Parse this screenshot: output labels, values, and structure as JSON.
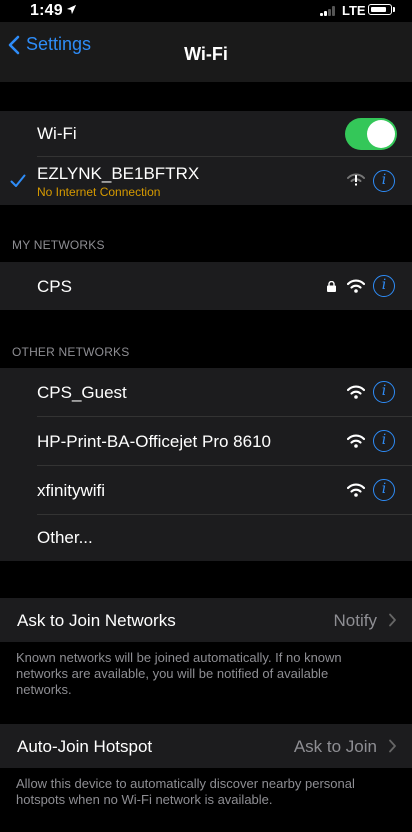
{
  "status_bar": {
    "time": "1:49",
    "network": "LTE"
  },
  "nav": {
    "back_label": "Settings",
    "title": "Wi-Fi"
  },
  "wifi_toggle": {
    "label": "Wi-Fi",
    "on": true
  },
  "connected_network": {
    "name": "EZLYNK_BE1BFTRX",
    "status": "No Internet Connection"
  },
  "my_networks": {
    "header": "MY NETWORKS",
    "items": [
      {
        "name": "CPS",
        "secured": true
      }
    ]
  },
  "other_networks": {
    "header": "OTHER NETWORKS",
    "items": [
      {
        "name": "CPS_Guest"
      },
      {
        "name": "HP-Print-BA-Officejet Pro 8610"
      },
      {
        "name": "xfinitywifi"
      }
    ],
    "other_label": "Other..."
  },
  "ask_to_join": {
    "label": "Ask to Join Networks",
    "value": "Notify",
    "note": "Known networks will be joined automatically. If no known networks are available, you will be notified of available networks."
  },
  "auto_join_hotspot": {
    "label": "Auto-Join Hotspot",
    "value": "Ask to Join",
    "note": "Allow this device to automatically discover nearby personal hotspots when no Wi-Fi network is available."
  },
  "colors": {
    "accent": "#2e8cf7",
    "toggle_on": "#34c759",
    "warning": "#d69a00"
  }
}
